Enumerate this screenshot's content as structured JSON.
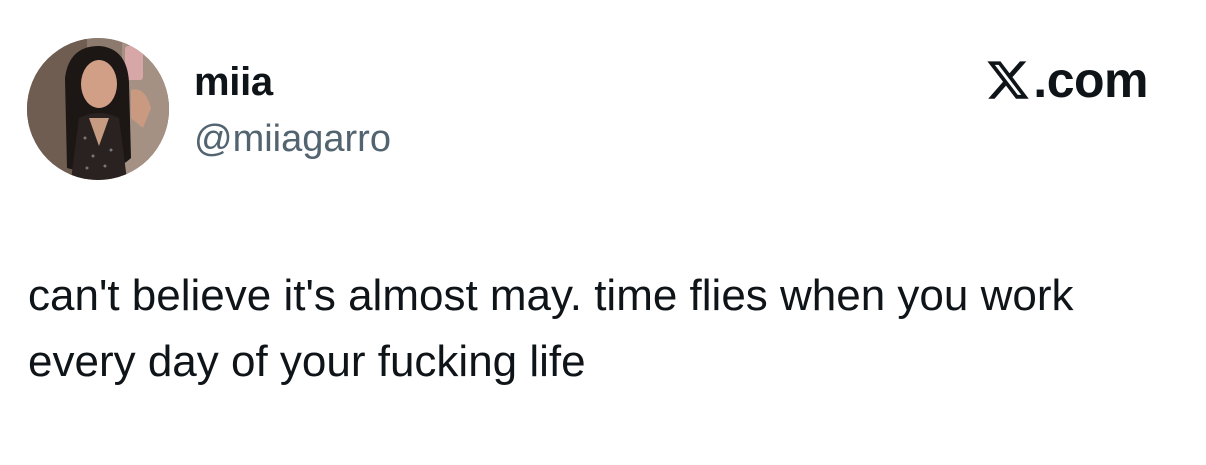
{
  "author": {
    "display_name": "miia",
    "handle": "@miiagarro",
    "avatar_icon": "profile-photo"
  },
  "brand": {
    "logo_icon": "x-logo-icon",
    "text": ".com"
  },
  "tweet": {
    "text": "can't believe it's almost may. time flies when you work every day of your fucking life"
  },
  "colors": {
    "text_primary": "#0f1419",
    "text_secondary": "#536471",
    "background": "#ffffff"
  }
}
